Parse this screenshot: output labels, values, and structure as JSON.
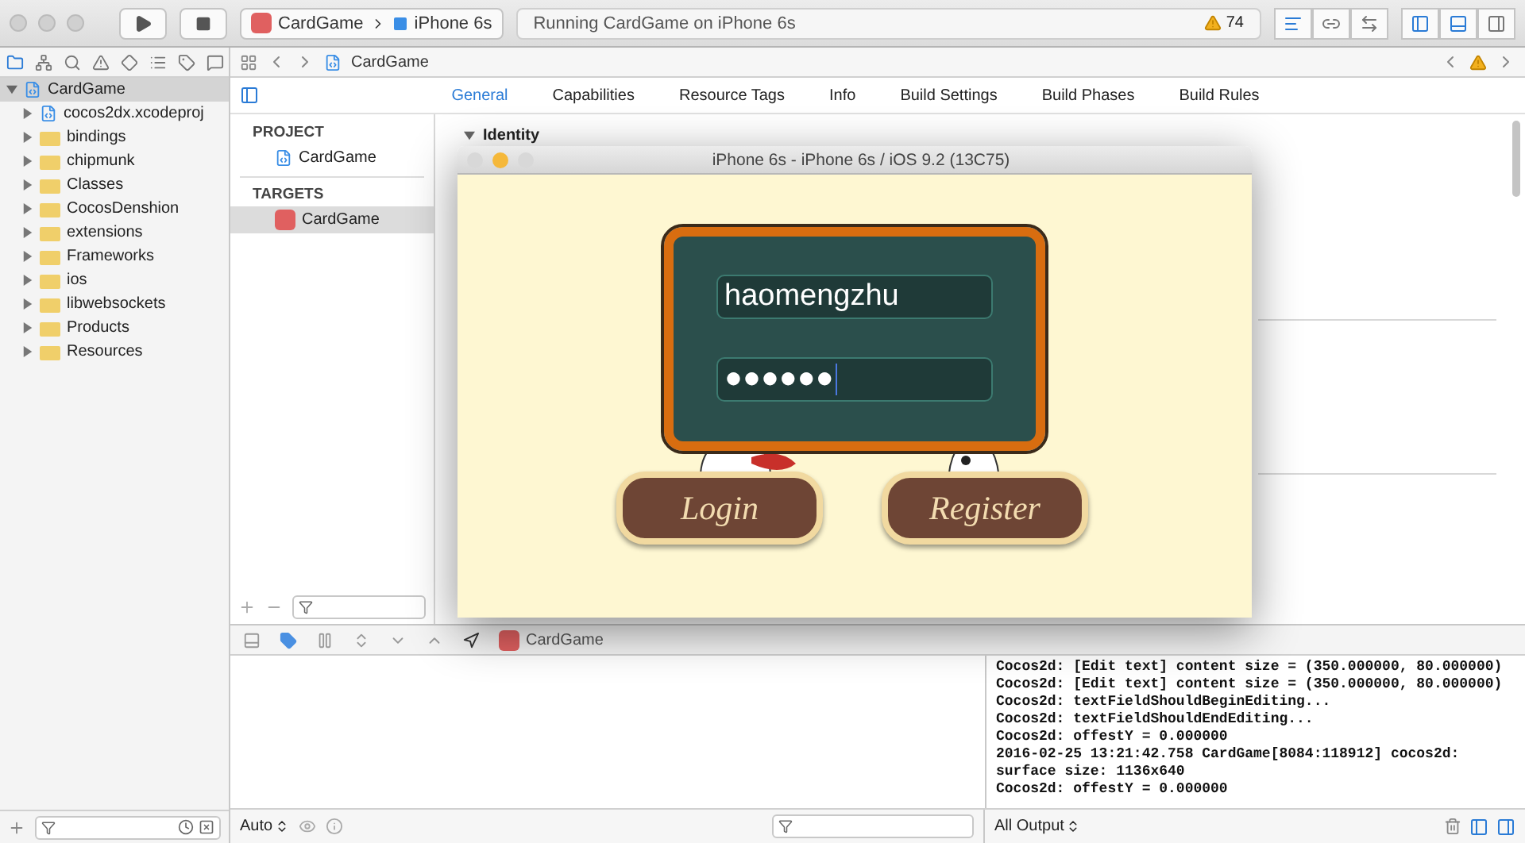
{
  "toolbar": {
    "scheme": "CardGame",
    "device": "iPhone 6s",
    "status": "Running CardGame on iPhone 6s",
    "warning_count": "74"
  },
  "navigator": {
    "tree": [
      {
        "label": "CardGame",
        "kind": "project",
        "expanded": true,
        "selected": true,
        "children": [
          {
            "label": "cocos2dx.xcodeproj",
            "kind": "project",
            "expanded": false,
            "selected": false
          },
          {
            "label": "bindings",
            "kind": "folder",
            "expanded": false,
            "selected": false
          },
          {
            "label": "chipmunk",
            "kind": "folder",
            "expanded": false,
            "selected": false
          },
          {
            "label": "Classes",
            "kind": "folder",
            "expanded": false,
            "selected": false
          },
          {
            "label": "CocosDenshion",
            "kind": "folder",
            "expanded": false,
            "selected": false
          },
          {
            "label": "extensions",
            "kind": "folder",
            "expanded": false,
            "selected": false
          },
          {
            "label": "Frameworks",
            "kind": "folder",
            "expanded": false,
            "selected": false
          },
          {
            "label": "ios",
            "kind": "folder",
            "expanded": false,
            "selected": false
          },
          {
            "label": "libwebsockets",
            "kind": "folder",
            "expanded": false,
            "selected": false
          },
          {
            "label": "Products",
            "kind": "folder",
            "expanded": false,
            "selected": false
          },
          {
            "label": "Resources",
            "kind": "folder",
            "expanded": false,
            "selected": false
          }
        ]
      }
    ]
  },
  "jump_bar": {
    "path": "CardGame"
  },
  "editor_tabs": [
    {
      "label": "General",
      "selected": true
    },
    {
      "label": "Capabilities",
      "selected": false
    },
    {
      "label": "Resource Tags",
      "selected": false
    },
    {
      "label": "Info",
      "selected": false
    },
    {
      "label": "Build Settings",
      "selected": false
    },
    {
      "label": "Build Phases",
      "selected": false
    },
    {
      "label": "Build Rules",
      "selected": false
    }
  ],
  "project_list": {
    "sections": [
      {
        "title": "PROJECT",
        "items": [
          {
            "label": "CardGame",
            "kind": "project",
            "selected": false
          }
        ]
      },
      {
        "title": "TARGETS",
        "items": [
          {
            "label": "CardGame",
            "kind": "target",
            "selected": true
          }
        ]
      }
    ]
  },
  "identity": {
    "title": "Identity",
    "expanded": true
  },
  "simulator": {
    "title": "iPhone 6s - iPhone 6s / iOS 9.2 (13C75)",
    "username": "haomengzhu",
    "password": "●●●●●●",
    "buttons": [
      "Login",
      "Register"
    ]
  },
  "debug_bar": {
    "target": "CardGame"
  },
  "variables": {
    "scope": "Auto"
  },
  "console": {
    "lines": [
      "Cocos2d: [Edit text] content size = (350.000000, 80.000000)",
      "Cocos2d: [Edit text] content size = (350.000000, 80.000000)",
      "Cocos2d: textFieldShouldBeginEditing...",
      "Cocos2d: textFieldShouldEndEditing...",
      "Cocos2d: offestY = 0.000000",
      "2016-02-25 13:21:42.758 CardGame[8084:118912] cocos2d: surface size: 1136x640",
      "Cocos2d: offestY = 0.000000"
    ],
    "filter": "All Output"
  }
}
